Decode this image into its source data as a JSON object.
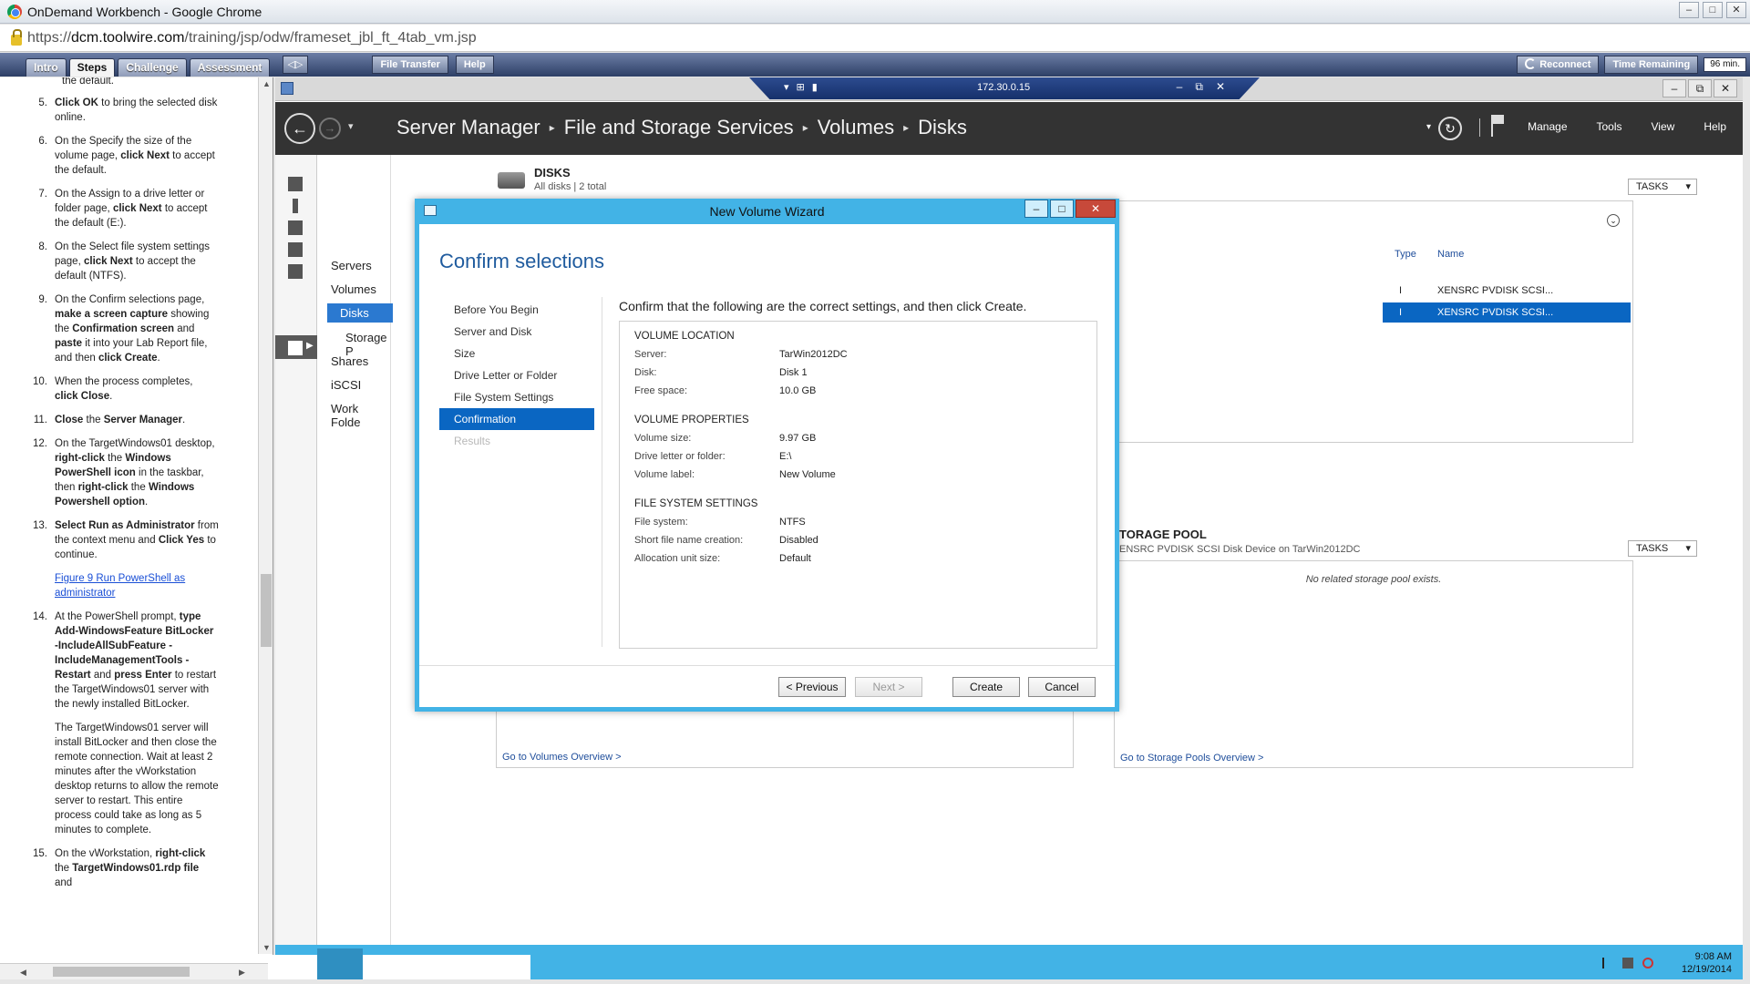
{
  "browser": {
    "title": "OnDemand Workbench - Google Chrome",
    "url_prefix": "https://",
    "url_host": "dcm.toolwire.com",
    "url_path": "/training/jsp/odw/frameset_jbl_ft_4tab_vm.jsp"
  },
  "toolwire": {
    "tabs": [
      "Intro",
      "Steps",
      "Challenge",
      "Assessment"
    ],
    "active_tab": "Steps",
    "file_transfer": "File Transfer",
    "help": "Help",
    "reconnect": "Reconnect",
    "time_remaining": "Time Remaining",
    "time_value": "96 min."
  },
  "steps_panel": {
    "top_fragment": "the default.",
    "steps": [
      {
        "num": "5.",
        "html": "<b>Click OK</b> to bring the selected disk online."
      },
      {
        "num": "6.",
        "html": "On the Specify the size of the volume page, <b>click Next</b> to accept the default."
      },
      {
        "num": "7.",
        "html": "On the Assign to a drive letter or folder page, <b>click Next</b> to accept the default (E:)."
      },
      {
        "num": "8.",
        "html": "On the Select file system settings page, <b>click Next</b> to accept the default (NTFS)."
      },
      {
        "num": "9.",
        "html": "On the Confirm selections page, <b>make a screen capture</b> showing the <b>Confirmation screen</b> and <b>paste</b> it into your Lab Report file, and then <b>click Create</b>."
      },
      {
        "num": "10.",
        "html": "When the process completes, <b>click Close</b>."
      },
      {
        "num": "11.",
        "html": "<b>Close</b> the <b>Server Manager</b>."
      },
      {
        "num": "12.",
        "html": "On the TargetWindows01 desktop, <b>right-click</b> the <b>Windows PowerShell icon</b> in the taskbar, then <b>right-click</b> the <b>Windows Powershell option</b>."
      },
      {
        "num": "13.",
        "html": "<b>Select Run as Administrator</b> from the context menu and <b>Click Yes</b> to continue."
      },
      {
        "num": "",
        "html": "<a>Figure 9 Run PowerShell as administrator</a>"
      },
      {
        "num": "14.",
        "html": "At the PowerShell prompt, <b>type Add-WindowsFeature BitLocker -IncludeAllSubFeature -IncludeManagementTools -Restart</b> and <b>press Enter</b> to restart the TargetWindows01 server with the newly installed BitLocker."
      },
      {
        "num": "",
        "html": "The TargetWindows01 server will install BitLocker and then close the remote connection. Wait at least 2 minutes after the vWorkstation desktop returns to allow the remote server to restart. This entire process could take as long as 5 minutes to complete."
      },
      {
        "num": "15.",
        "html": "On the vWorkstation, <b>right-click</b> the <b>TargetWindows01.rdp file</b> and"
      }
    ]
  },
  "rdp": {
    "host": "172.30.0.15"
  },
  "server_manager": {
    "breadcrumb": [
      "Server Manager",
      "File and Storage Services",
      "Volumes",
      "Disks"
    ],
    "menu": [
      "Manage",
      "Tools",
      "View",
      "Help"
    ],
    "nav": [
      "Servers",
      "Volumes",
      "Disks",
      "Storage P",
      "Shares",
      "iSCSI",
      "Work Folde"
    ],
    "nav_selected": "Disks",
    "disks_title": "DISKS",
    "disks_sub": "All disks | 2 total",
    "tasks": "TASKS",
    "disk_columns": [
      "Type",
      "Name"
    ],
    "disk_rows": [
      {
        "type": "I",
        "name": "XENSRC PVDISK SCSI..."
      },
      {
        "type": "I",
        "name": "XENSRC PVDISK SCSI..."
      }
    ],
    "pool_title": "TORAGE POOL",
    "pool_sub": "ENSRC PVDISK SCSI Disk Device on TarWin2012DC",
    "pool_empty": "No related storage pool exists.",
    "link_volumes": "Go to Volumes Overview >",
    "link_pools": "Go to Storage Pools Overview >"
  },
  "taskbar": {
    "time": "9:08 AM",
    "date": "12/19/2014"
  },
  "wizard": {
    "title": "New Volume Wizard",
    "heading": "Confirm selections",
    "steps": [
      "Before You Begin",
      "Server and Disk",
      "Size",
      "Drive Letter or Folder",
      "File System Settings",
      "Confirmation",
      "Results"
    ],
    "active_step": "Confirmation",
    "intro": "Confirm that the following are the correct settings, and then click Create.",
    "sections": [
      {
        "title": "VOLUME LOCATION",
        "rows": [
          [
            "Server:",
            "TarWin2012DC"
          ],
          [
            "Disk:",
            "Disk 1"
          ],
          [
            "Free space:",
            "10.0 GB"
          ]
        ]
      },
      {
        "title": "VOLUME PROPERTIES",
        "rows": [
          [
            "Volume size:",
            "9.97 GB"
          ],
          [
            "Drive letter or folder:",
            "E:\\"
          ],
          [
            "Volume label:",
            "New Volume"
          ]
        ]
      },
      {
        "title": "FILE SYSTEM SETTINGS",
        "rows": [
          [
            "File system:",
            "NTFS"
          ],
          [
            "Short file name creation:",
            "Disabled"
          ],
          [
            "Allocation unit size:",
            "Default"
          ]
        ]
      }
    ],
    "buttons": {
      "previous": "< Previous",
      "next": "Next >",
      "create": "Create",
      "cancel": "Cancel"
    }
  }
}
